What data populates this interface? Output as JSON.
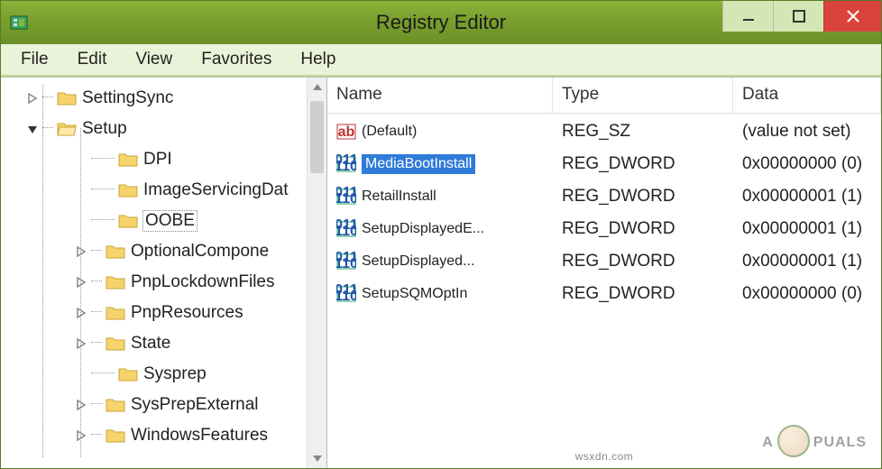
{
  "window": {
    "title": "Registry Editor"
  },
  "menubar": [
    "File",
    "Edit",
    "View",
    "Favorites",
    "Help"
  ],
  "tree": {
    "top": {
      "label": "SettingSync",
      "expandable": true
    },
    "setup": {
      "label": "Setup"
    },
    "children": [
      {
        "label": "DPI",
        "expandable": false
      },
      {
        "label": "ImageServicingDat",
        "expandable": false
      },
      {
        "label": "OOBE",
        "expandable": false,
        "selected": true
      },
      {
        "label": "OptionalCompone",
        "expandable": true
      },
      {
        "label": "PnpLockdownFiles",
        "expandable": true
      },
      {
        "label": "PnpResources",
        "expandable": true
      },
      {
        "label": "State",
        "expandable": true
      },
      {
        "label": "Sysprep",
        "expandable": false
      },
      {
        "label": "SysPrepExternal",
        "expandable": true
      },
      {
        "label": "WindowsFeatures",
        "expandable": true
      }
    ]
  },
  "list": {
    "columns": {
      "name": "Name",
      "type": "Type",
      "data": "Data"
    },
    "rows": [
      {
        "name": "(Default)",
        "type": "REG_SZ",
        "data": "(value not set)",
        "icon": "sz",
        "selected": false
      },
      {
        "name": "MediaBootInstall",
        "type": "REG_DWORD",
        "data": "0x00000000 (0)",
        "icon": "dword",
        "selected": true
      },
      {
        "name": "RetailInstall",
        "type": "REG_DWORD",
        "data": "0x00000001 (1)",
        "icon": "dword",
        "selected": false
      },
      {
        "name": "SetupDisplayedE...",
        "type": "REG_DWORD",
        "data": "0x00000001 (1)",
        "icon": "dword",
        "selected": false
      },
      {
        "name": "SetupDisplayed...",
        "type": "REG_DWORD",
        "data": "0x00000001 (1)",
        "icon": "dword",
        "selected": false
      },
      {
        "name": "SetupSQMOptIn",
        "type": "REG_DWORD",
        "data": "0x00000000 (0)",
        "icon": "dword",
        "selected": false
      }
    ]
  },
  "watermark": {
    "text_left": "A",
    "text_right": "PUALS"
  },
  "footer": "wsxdn.com"
}
